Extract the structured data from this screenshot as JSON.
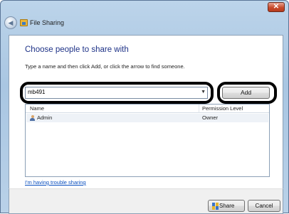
{
  "window": {
    "title": "File Sharing",
    "close_glyph": "✕",
    "back_glyph": "◀"
  },
  "main": {
    "heading": "Choose people to share with",
    "instructions": "Type a name and then click Add, or click the arrow to find someone.",
    "name_input_value": "mb491",
    "dropdown_glyph": "▼",
    "add_label": "Add"
  },
  "table": {
    "columns": [
      "Name",
      "Permission Level"
    ],
    "rows": [
      {
        "name": "Admin",
        "permission": "Owner"
      }
    ]
  },
  "help_link": "I'm having trouble sharing",
  "footer": {
    "share_label": "Share",
    "cancel_label": "Cancel"
  },
  "icons": {
    "back": "back-arrow-icon",
    "title": "file-sharing-icon",
    "user": "user-icon",
    "shield": "uac-shield-icon"
  },
  "colors": {
    "heading": "#1e3287",
    "link": "#0a4fbf",
    "titlebar": "#bcd4ea",
    "close_button": "#c84b2c",
    "annotation": "#000000"
  }
}
